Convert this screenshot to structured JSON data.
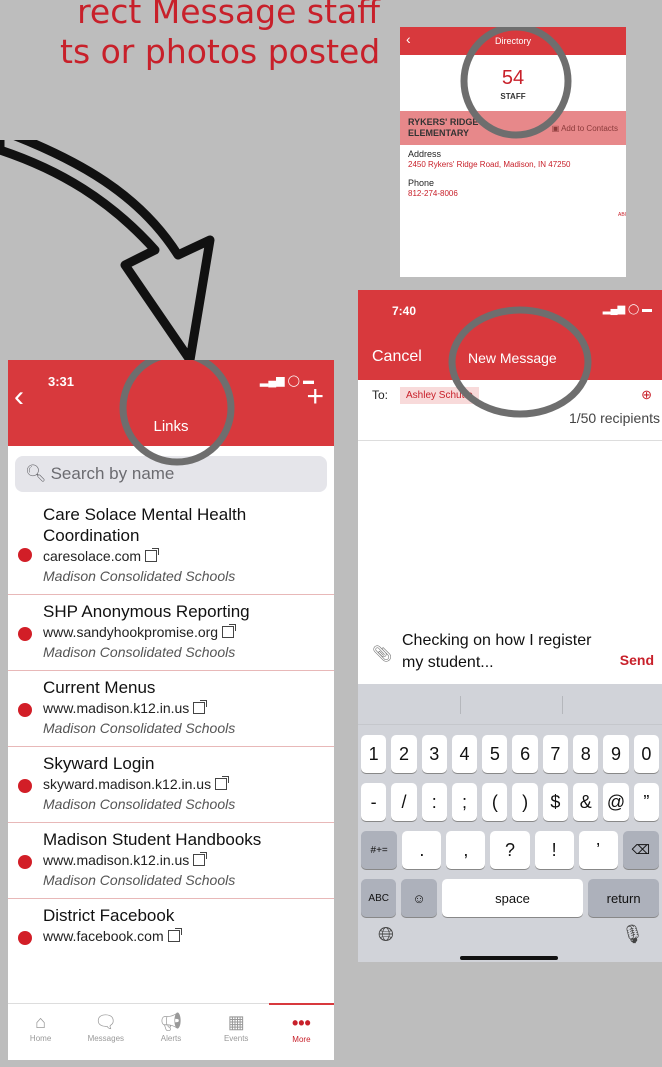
{
  "headline": {
    "line1": "rect Message staff",
    "line2": "ts or photos posted"
  },
  "directory": {
    "title": "Directory",
    "count": "54",
    "count_label": "STAFF",
    "school": "RYKERS' RIDGE ELEMENTARY",
    "add_contacts": "Add to Contacts",
    "address_label": "Address",
    "address_value": "2450 Rykers' Ridge Road, Madison, IN 47250",
    "phone_label": "Phone",
    "phone_value": "812-274-8006",
    "index": "ABCDEFG"
  },
  "links_screen": {
    "time": "3:31",
    "title": "Links",
    "search_placeholder": "Search by name",
    "items": [
      {
        "title": "Care Solace Mental Health Coordination",
        "url": "caresolace.com",
        "org": "Madison Consolidated Schools"
      },
      {
        "title": "SHP Anonymous Reporting",
        "url": "www.sandyhookpromise.org",
        "org": "Madison Consolidated Schools"
      },
      {
        "title": "Current Menus",
        "url": "www.madison.k12.in.us",
        "org": "Madison Consolidated Schools"
      },
      {
        "title": "Skyward Login",
        "url": "skyward.madison.k12.in.us",
        "org": "Madison Consolidated Schools"
      },
      {
        "title": "Madison Student Handbooks",
        "url": "www.madison.k12.in.us",
        "org": "Madison Consolidated Schools"
      },
      {
        "title": "District Facebook",
        "url": "www.facebook.com",
        "org": ""
      }
    ],
    "tabs": [
      {
        "label": "Home",
        "icon": "home-icon"
      },
      {
        "label": "Messages",
        "icon": "messages-icon"
      },
      {
        "label": "Alerts",
        "icon": "megaphone-icon"
      },
      {
        "label": "Events",
        "icon": "calendar-icon"
      },
      {
        "label": "More",
        "icon": "more-icon"
      }
    ]
  },
  "message_screen": {
    "time": "7:40",
    "cancel": "Cancel",
    "title": "New Message",
    "to_label": "To:",
    "recipient": "Ashley Schutte",
    "recipient_count": "1/50 recipients",
    "compose_text": "Checking on how I register my student...",
    "send": "Send",
    "keyboard": {
      "row1": [
        "1",
        "2",
        "3",
        "4",
        "5",
        "6",
        "7",
        "8",
        "9",
        "0"
      ],
      "row2": [
        "-",
        "/",
        ":",
        ";",
        "(",
        ")",
        "$",
        "&",
        "@",
        "”"
      ],
      "row3": [
        ".",
        ",",
        "?",
        "!",
        "’"
      ],
      "mode_symbols": "#+=",
      "mode_abc": "ABC",
      "space": "space",
      "return": "return"
    }
  },
  "colors": {
    "brand": "#d8393d",
    "accent": "#c8202a",
    "background": "#bdbdbd"
  }
}
